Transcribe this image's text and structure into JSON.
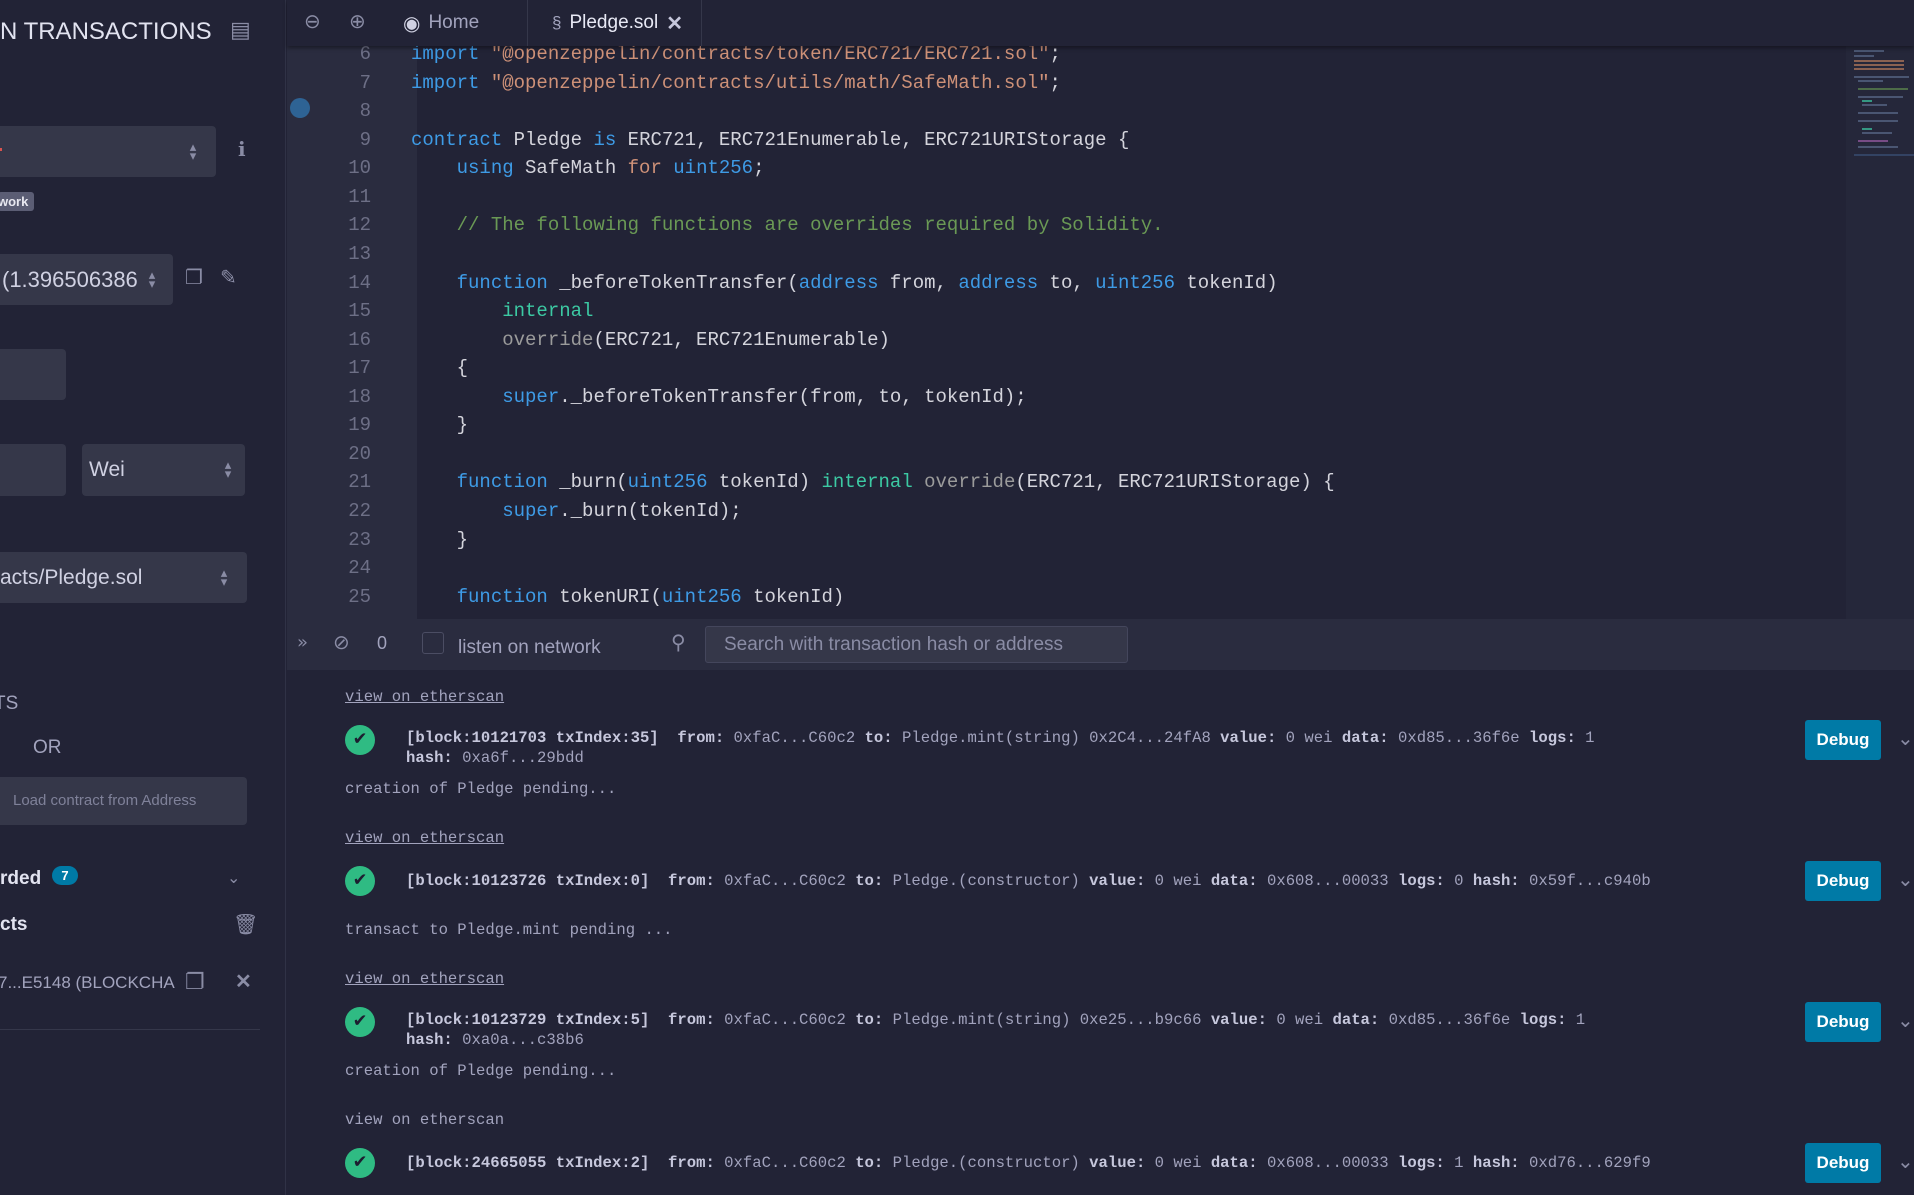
{
  "sidebar": {
    "title": "N TRANSACTIONS",
    "network_badge": "work",
    "account_value": "(1.396506386",
    "unit_select": "Wei",
    "contract_select": "acts/Pledge.sol",
    "section_label": "TS",
    "or_label": "OR",
    "load_placeholder": "Load contract from Address",
    "recorded_label": "rded",
    "recorded_count": "7",
    "deployed_label": "cts",
    "deployed_instance": "7...E5148 (BLOCKCHA"
  },
  "tabs": [
    {
      "label": "Home",
      "icon": "remix-logo-icon"
    },
    {
      "label": "Pledge.sol",
      "icon": "solidity-icon",
      "active": true
    }
  ],
  "code": [
    {
      "n": "6",
      "t": [
        [
          "import ",
          "kw"
        ],
        [
          "\"@openzeppelin/contracts/token/ERC721/ERC721.sol\"",
          "str"
        ],
        [
          ";",
          "tx"
        ]
      ]
    },
    {
      "n": "7",
      "t": [
        [
          "import ",
          "kw"
        ],
        [
          "\"@openzeppelin/contracts/utils/math/SafeMath.sol\"",
          "str"
        ],
        [
          ";",
          "tx"
        ]
      ]
    },
    {
      "n": "8",
      "t": []
    },
    {
      "n": "9",
      "t": [
        [
          "contract ",
          "kw"
        ],
        [
          "Pledge ",
          "tx"
        ],
        [
          "is ",
          "kw"
        ],
        [
          "ERC721, ERC721Enumerable, ERC721URIStorage {",
          "tx"
        ]
      ]
    },
    {
      "n": "10",
      "t": [
        [
          "    using ",
          "kw"
        ],
        [
          "SafeMath ",
          "tx"
        ],
        [
          "for ",
          "str"
        ],
        [
          "uint256",
          "kw"
        ],
        [
          ";",
          "tx"
        ]
      ]
    },
    {
      "n": "11",
      "t": []
    },
    {
      "n": "12",
      "t": [
        [
          "    // The following functions are overrides required by Solidity.",
          "cm"
        ]
      ]
    },
    {
      "n": "13",
      "t": []
    },
    {
      "n": "14",
      "t": [
        [
          "    function ",
          "kw"
        ],
        [
          "_beforeTokenTransfer(",
          "tx"
        ],
        [
          "address ",
          "kw"
        ],
        [
          "from, ",
          "tx"
        ],
        [
          "address ",
          "kw"
        ],
        [
          "to, ",
          "tx"
        ],
        [
          "uint256 ",
          "kw"
        ],
        [
          "tokenId)",
          "tx"
        ]
      ]
    },
    {
      "n": "15",
      "t": [
        [
          "        internal",
          "gr"
        ]
      ]
    },
    {
      "n": "16",
      "t": [
        [
          "        override",
          "ov"
        ],
        [
          "(ERC721, ERC721Enumerable)",
          "tx"
        ]
      ]
    },
    {
      "n": "17",
      "t": [
        [
          "    {",
          "tx"
        ]
      ]
    },
    {
      "n": "18",
      "t": [
        [
          "        super",
          "kw"
        ],
        [
          "._beforeTokenTransfer(from, to, tokenId);",
          "tx"
        ]
      ]
    },
    {
      "n": "19",
      "t": [
        [
          "    }",
          "tx"
        ]
      ]
    },
    {
      "n": "20",
      "t": []
    },
    {
      "n": "21",
      "t": [
        [
          "    function ",
          "kw"
        ],
        [
          "_burn(",
          "tx"
        ],
        [
          "uint256 ",
          "kw"
        ],
        [
          "tokenId) ",
          "tx"
        ],
        [
          "internal ",
          "gr"
        ],
        [
          "override",
          "ov"
        ],
        [
          "(ERC721, ERC721URIStorage) {",
          "tx"
        ]
      ]
    },
    {
      "n": "22",
      "t": [
        [
          "        super",
          "kw"
        ],
        [
          "._burn(tokenId);",
          "tx"
        ]
      ]
    },
    {
      "n": "23",
      "t": [
        [
          "    }",
          "tx"
        ]
      ]
    },
    {
      "n": "24",
      "t": []
    },
    {
      "n": "25",
      "t": [
        [
          "    function ",
          "kw"
        ],
        [
          "tokenURI(",
          "tx"
        ],
        [
          "uint256 ",
          "kw"
        ],
        [
          "tokenId)",
          "tx"
        ]
      ]
    }
  ],
  "terminal": {
    "pending_count": "0",
    "listen_label": "listen on network",
    "search_placeholder": "Search with transaction hash or address",
    "debug_label": "Debug",
    "entries": [
      {
        "pre": "view on etherscan",
        "link": true,
        "tx": [
          [
            "[block:10121703 txIndex:35]",
            1
          ],
          [
            "  ",
            0
          ],
          [
            "from:",
            1
          ],
          [
            " 0xfaC...C60c2 ",
            0
          ],
          [
            "to:",
            1
          ],
          [
            " Pledge.mint(string) 0x2C4...24fA8 ",
            0
          ],
          [
            "value:",
            1
          ],
          [
            " 0 wei ",
            0
          ],
          [
            "data:",
            1
          ],
          [
            " 0xd85...36f6e ",
            0
          ],
          [
            "logs:",
            1
          ],
          [
            " 1\n",
            0
          ],
          [
            "hash:",
            1
          ],
          [
            " 0xa6f...29bdd",
            0
          ]
        ],
        "post": "creation of Pledge pending..."
      },
      {
        "pre": "view on etherscan",
        "link": true,
        "tx": [
          [
            "[block:10123726 txIndex:0]",
            1
          ],
          [
            "  ",
            0
          ],
          [
            "from:",
            1
          ],
          [
            " 0xfaC...C60c2 ",
            0
          ],
          [
            "to:",
            1
          ],
          [
            " Pledge.(constructor) ",
            0
          ],
          [
            "value:",
            1
          ],
          [
            " 0 wei ",
            0
          ],
          [
            "data:",
            1
          ],
          [
            " 0x608...00033 ",
            0
          ],
          [
            "logs:",
            1
          ],
          [
            " 0 ",
            0
          ],
          [
            "hash:",
            1
          ],
          [
            " 0x59f...c940b",
            0
          ]
        ],
        "post": "transact to Pledge.mint pending ..."
      },
      {
        "pre": "view on etherscan",
        "link": true,
        "tx": [
          [
            "[block:10123729 txIndex:5]",
            1
          ],
          [
            "  ",
            0
          ],
          [
            "from:",
            1
          ],
          [
            " 0xfaC...C60c2 ",
            0
          ],
          [
            "to:",
            1
          ],
          [
            " Pledge.mint(string) 0xe25...b9c66 ",
            0
          ],
          [
            "value:",
            1
          ],
          [
            " 0 wei ",
            0
          ],
          [
            "data:",
            1
          ],
          [
            " 0xd85...36f6e ",
            0
          ],
          [
            "logs:",
            1
          ],
          [
            " 1\n",
            0
          ],
          [
            "hash:",
            1
          ],
          [
            " 0xa0a...c38b6",
            0
          ]
        ],
        "post": "creation of Pledge pending..."
      },
      {
        "pre": "view on etherscan",
        "link": false,
        "tx": [
          [
            "[block:24665055 txIndex:2]",
            1
          ],
          [
            "  ",
            0
          ],
          [
            "from:",
            1
          ],
          [
            " 0xfaC...C60c2 ",
            0
          ],
          [
            "to:",
            1
          ],
          [
            " Pledge.(constructor) ",
            0
          ],
          [
            "value:",
            1
          ],
          [
            " 0 wei ",
            0
          ],
          [
            "data:",
            1
          ],
          [
            " 0x608...00033 ",
            0
          ],
          [
            "logs:",
            1
          ],
          [
            " 1 ",
            0
          ],
          [
            "hash:",
            1
          ],
          [
            " 0xd76...629f9",
            0
          ]
        ],
        "post": ""
      }
    ]
  },
  "colors": {
    "accent": "#007aa6",
    "success": "#2fbb83",
    "background": "#222336",
    "badge": "#007aa6"
  }
}
